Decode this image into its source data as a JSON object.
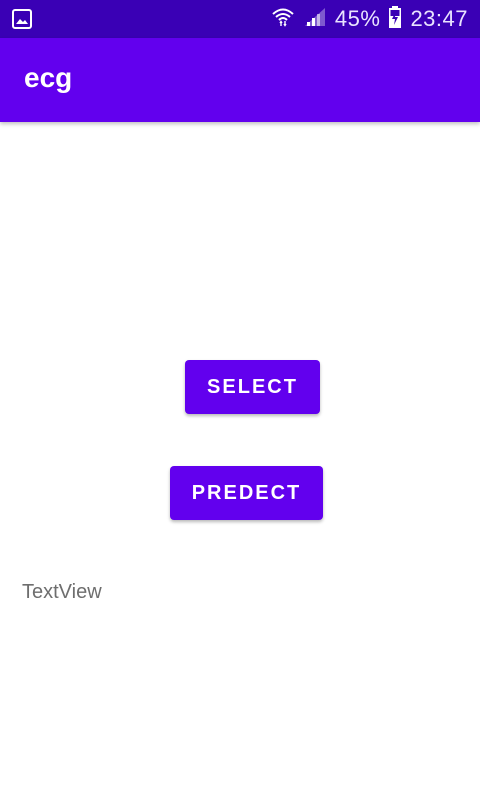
{
  "status_bar": {
    "icons": [
      "image-icon",
      "wifi-icon",
      "signal-icon",
      "battery-icon"
    ],
    "battery": "45%",
    "time": "23:47"
  },
  "app_bar": {
    "title": "ecg"
  },
  "main": {
    "select_label": "SELECT",
    "predict_label": "PREDECT",
    "text_view": "TextView"
  },
  "colors": {
    "status_bar": "#3a00b5",
    "primary": "#6200ee",
    "text_secondary": "#6e6e6e"
  }
}
